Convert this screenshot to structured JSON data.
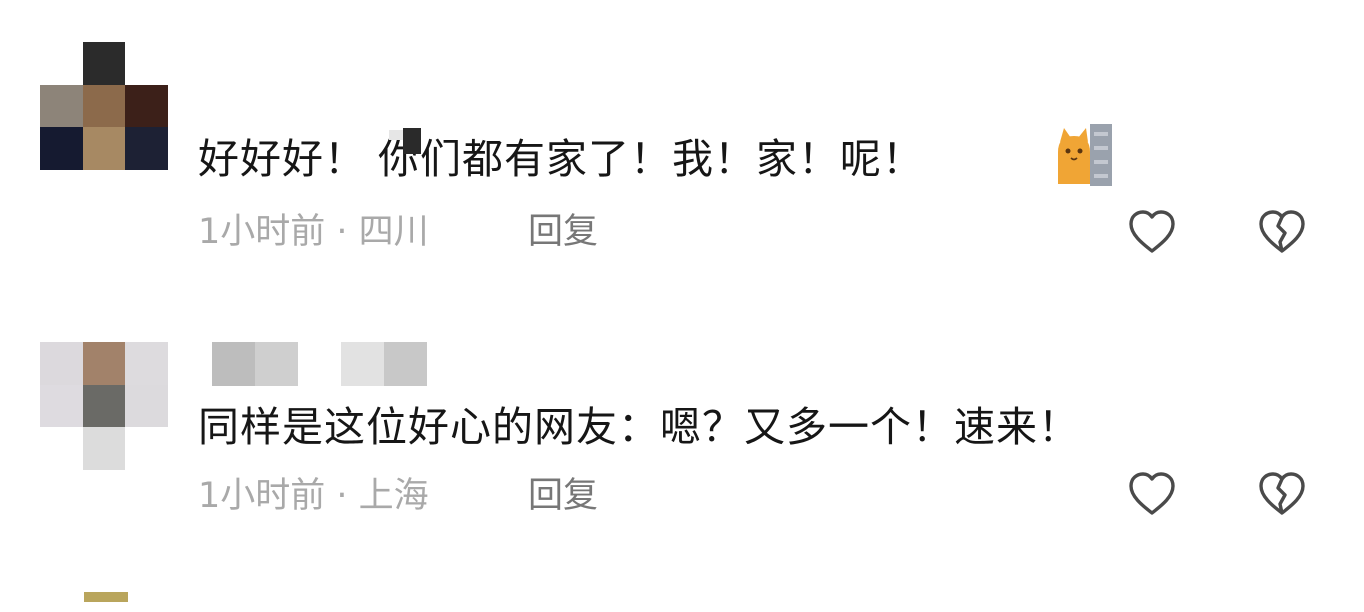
{
  "comments": [
    {
      "text_a": "好好好！",
      "text_b": "你们都有家了！我！家！呢！",
      "emoji": "cat-at-door-emoji",
      "time": "1小时前",
      "location": "四川",
      "reply_label": "回复",
      "avatar_pixels": [
        "#ffffff",
        "#2b2b2b",
        "#ffffff",
        "#8d8479",
        "#8c6a4b",
        "#3c2019",
        "#151a30",
        "#a78963",
        "#1d2134"
      ]
    },
    {
      "text": "同样是这位好心的网友：嗯？又多一个！速来！",
      "time": "1小时前",
      "location": "上海",
      "reply_label": "回复",
      "avatar_pixels": [
        "#dcd9dd",
        "#a2826a",
        "#dddbde",
        "#dedbe0",
        "#6a6a66",
        "#dcdadd",
        "#ffffff",
        "#dcdcdc",
        "#ffffff"
      ]
    }
  ],
  "colors": {
    "text": "#161616",
    "meta": "#a9a9a9",
    "reply": "#777777",
    "icon": "#4a4a4a"
  }
}
